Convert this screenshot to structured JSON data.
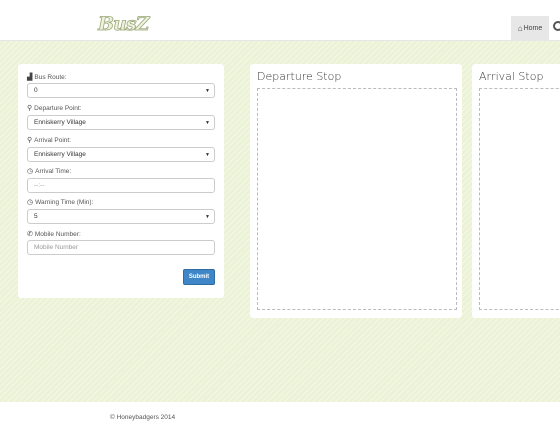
{
  "navbar": {
    "logo_text": "BusZ",
    "home_label": "Home",
    "home_icon": "home-icon"
  },
  "form": {
    "bus_route": {
      "label": "Bus Route:",
      "value": "0",
      "icon": "bus-icon"
    },
    "departure": {
      "label": "Departure Point:",
      "value": "Enniskerry Village",
      "icon": "map-marker-icon"
    },
    "arrival": {
      "label": "Arrival Point:",
      "value": "Enniskerry Village",
      "icon": "map-marker-icon"
    },
    "arrival_time": {
      "label": "Arrival Time:",
      "value": "--:--",
      "icon": "clock-icon"
    },
    "warning_time": {
      "label": "Warning Time (Min):",
      "value": "5",
      "icon": "clock-icon"
    },
    "mobile": {
      "label": "Mobile Number:",
      "placeholder": "Mobile Number",
      "icon": "phone-icon"
    },
    "submit_label": "Submit"
  },
  "panels": {
    "departure_title": "Departure Stop",
    "arrival_title": "Arrival Stop"
  },
  "footer": {
    "copyright": "© Honeybadgers 2014"
  },
  "colors": {
    "background": "#ecf2d6",
    "submit": "#3f86c8"
  }
}
